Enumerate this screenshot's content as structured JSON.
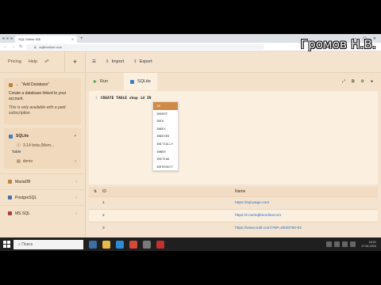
{
  "browser": {
    "tab_title": "SQL Online IDE",
    "new_tab": "+",
    "url": "sqliteonline.com"
  },
  "watermark": "Громов Н.В.",
  "sidebar": {
    "nav": [
      "Pricing",
      "Help"
    ],
    "add_db": {
      "title": "\"Add Database\"",
      "arrow": "→",
      "desc": "Create a database linked to your account.",
      "note": "This is only available with a paid subscription."
    },
    "sqlite": {
      "name": "SQLite",
      "version": "3.14 beta (Mem...",
      "table_label": "Table",
      "table_name": "demo"
    },
    "others": [
      "MariaDB",
      "PostgreSQL",
      "MS SQL"
    ]
  },
  "toolbar": {
    "import": "Import",
    "export": "Export"
  },
  "tabs": {
    "run": "Run",
    "sql": "SQLite"
  },
  "editor": {
    "line": "1",
    "code": "CREATE TABLE shop id IN",
    "autocomplete": [
      "IN",
      "INSERT",
      "INTO",
      "INDEX",
      "INDEXED",
      "INITIALLY",
      "INNER",
      "INSTEAD",
      "INTERSECT"
    ],
    "selected": "IN"
  },
  "results": {
    "headers": [
      "ID",
      "Name"
    ],
    "rows": [
      {
        "id": "1",
        "name": "https://sql-page.com"
      },
      {
        "id": "2",
        "name": "https://t.me/sqliteonlinecom"
      },
      {
        "id": "3",
        "name": "https://www.vuilt.com/?NP=8839760-92"
      }
    ]
  },
  "taskbar": {
    "search": "Поиск",
    "time": "18:21",
    "date": "17.04.2024"
  },
  "colors": {
    "bg": "#f4e3cf",
    "accent": "#d08a45",
    "run": "#3b9a4a",
    "link": "#2b6fbf"
  }
}
